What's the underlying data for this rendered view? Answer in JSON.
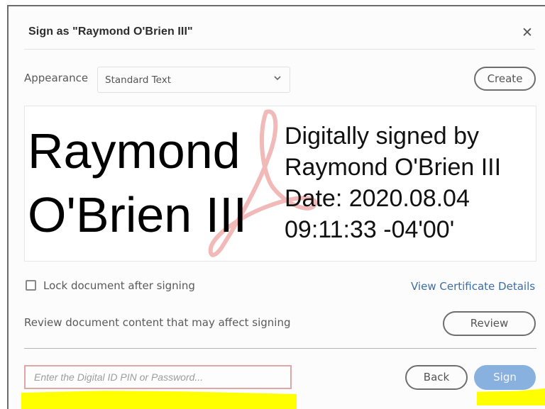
{
  "dialog": {
    "title": "Sign as \"Raymond O'Brien III\"",
    "close_icon": "close-icon"
  },
  "appearance": {
    "label": "Appearance",
    "selected": "Standard Text",
    "create_label": "Create"
  },
  "preview": {
    "name_line1": "Raymond",
    "name_line2": "O'Brien III",
    "details": [
      "Digitally signed by",
      "Raymond O'Brien III",
      "Date: 2020.08.04",
      "09:11:33 -04'00'"
    ],
    "watermark_icon": "adobe-acrobat-icon"
  },
  "options": {
    "lock_label": "Lock document after signing",
    "lock_checked": false,
    "cert_link": "View Certificate Details",
    "review_text": "Review document content that may affect signing",
    "review_label": "Review"
  },
  "footer": {
    "pin_placeholder": "Enter the Digital ID PIN or Password...",
    "pin_value": "",
    "back_label": "Back",
    "sign_label": "Sign"
  },
  "colors": {
    "link": "#3d6ea8",
    "sign_button": "#88b1e0",
    "pin_border": "#e0a5a5",
    "highlight": "#ffff00"
  }
}
